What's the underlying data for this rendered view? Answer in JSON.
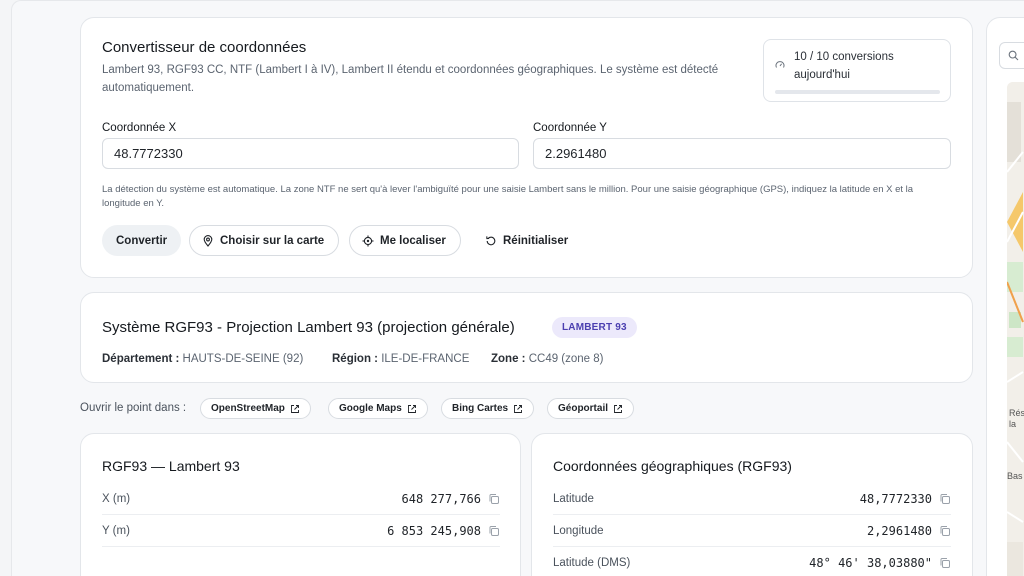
{
  "header": {
    "title": "Convertisseur de coordonnées",
    "subtitle": "Lambert 93, RGF93 CC, NTF (Lambert I à IV), Lambert II étendu et coordonnées géographiques. Le système est détecté automatiquement."
  },
  "quota": {
    "text": "10 / 10 conversions aujourd'hui",
    "used_fraction": 1.0,
    "bar_color": "#e4e7ec"
  },
  "form": {
    "x_label": "Coordonnée X",
    "x_value": "48.7772330",
    "y_label": "Coordonnée Y",
    "y_value": "2.2961480",
    "hint": "La détection du système est automatique. La zone NTF ne sert qu'à lever l'ambiguïté pour une saisie Lambert sans le million. Pour une saisie géographique (GPS), indiquez la latitude en X et la longitude en Y."
  },
  "actions": {
    "convert": "Convertir",
    "pick_map": "Choisir sur la carte",
    "locate": "Me localiser",
    "reset": "Réinitialiser"
  },
  "system": {
    "title": "Système RGF93 - Projection Lambert 93 (projection générale)",
    "badge": "LAMBERT 93",
    "badge_color": "#4b3fb0",
    "departement_label": "Département :",
    "departement_value": "HAUTS-DE-SEINE (92)",
    "region_label": "Région :",
    "region_value": "ILE-DE-FRANCE",
    "zone_label": "Zone :",
    "zone_value": "CC49 (zone 8)"
  },
  "open_in": {
    "label": "Ouvrir le point dans :",
    "links": [
      "OpenStreetMap",
      "Google Maps",
      "Bing Cartes",
      "Géoportail"
    ]
  },
  "lambert_card": {
    "title": "RGF93 — Lambert 93",
    "rows": [
      {
        "label": "X (m)",
        "value": "648 277,766"
      },
      {
        "label": "Y (m)",
        "value": "6 853 245,908"
      }
    ]
  },
  "geo_card": {
    "title": "Coordonnées géographiques (RGF93)",
    "rows": [
      {
        "label": "Latitude",
        "value": "48,7772330"
      },
      {
        "label": "Longitude",
        "value": "2,2961480"
      },
      {
        "label": "Latitude (DMS)",
        "value": "48° 46' 38,03880\""
      }
    ]
  },
  "map_panel": {
    "labels": [
      "Rés",
      "la",
      "Bas"
    ]
  },
  "icons": {
    "quota": "gauge-icon",
    "pick_map": "map-pin-icon",
    "locate": "crosshair-icon",
    "reset": "rotate-ccw-icon",
    "external": "external-link-icon",
    "copy": "copy-icon",
    "search": "search-icon"
  }
}
